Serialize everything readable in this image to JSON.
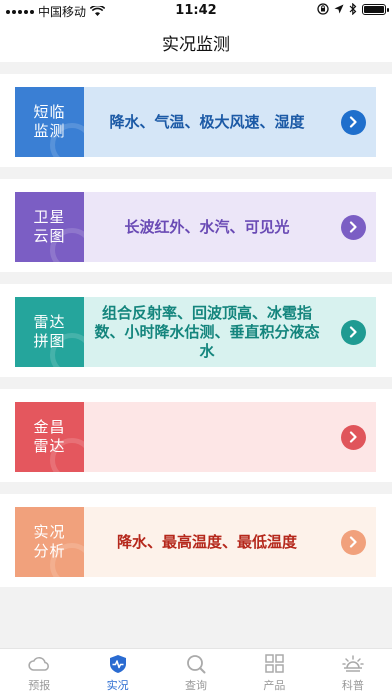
{
  "status_bar": {
    "carrier": "中国移动",
    "time": "11:42"
  },
  "nav": {
    "title": "实况监测"
  },
  "cards": [
    {
      "tag": "短临监测",
      "desc": "降水、气温、极大风速、湿度",
      "tag_color": "#3a7fd4",
      "bg": "#d5e6f7",
      "text_color": "#1c5aa6",
      "arrow_color": "#1f6fcc"
    },
    {
      "tag": "卫星云图",
      "desc": "长波红外、水汽、可见光",
      "tag_color": "#7b5ec4",
      "bg": "#ece6f8",
      "text_color": "#6a4bb5",
      "arrow_color": "#7b5ec4"
    },
    {
      "tag": "雷达拼图",
      "desc": "组合反射率、回波顶高、冰雹指数、小时降水估测、垂直积分液态水",
      "tag_color": "#25a59c",
      "bg": "#d8f2ef",
      "text_color": "#14857d",
      "arrow_color": "#1f9b92"
    },
    {
      "tag": "金昌雷达",
      "desc": "",
      "tag_color": "#e4575e",
      "bg": "#fde6e6",
      "text_color": "#c0393f",
      "arrow_color": "#e0555b"
    },
    {
      "tag": "实况分析",
      "desc": "降水、最高温度、最低温度",
      "tag_color": "#f1a17c",
      "bg": "#fdf2ea",
      "text_color": "#b5281c",
      "arrow_color": "#f1a17c"
    }
  ],
  "tabs": [
    {
      "label": "预报",
      "icon": "cloud-icon"
    },
    {
      "label": "实况",
      "icon": "monitor-icon"
    },
    {
      "label": "查询",
      "icon": "search-icon"
    },
    {
      "label": "产品",
      "icon": "grid-icon"
    },
    {
      "label": "科普",
      "icon": "sunrise-icon"
    }
  ]
}
